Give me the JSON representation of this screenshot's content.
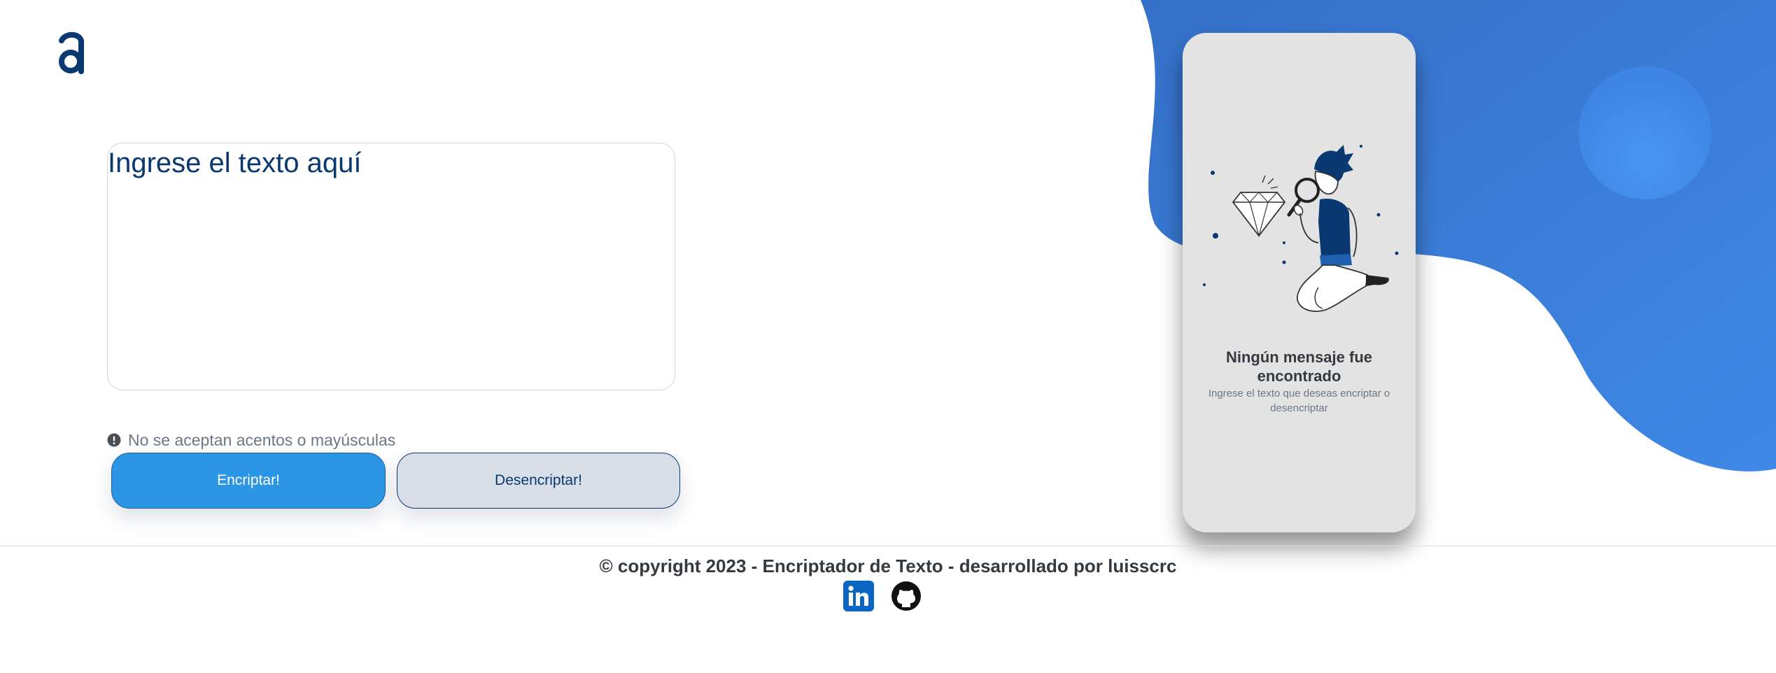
{
  "header": {
    "logo_icon": "alura-logo-icon"
  },
  "input": {
    "placeholder": "Ingrese el texto aquí"
  },
  "warning": {
    "icon": "exclamation-circle-icon",
    "text": "No se aceptan acentos o mayúsculas"
  },
  "buttons": {
    "encrypt_label": "Encriptar!",
    "decrypt_label": "Desencriptar!"
  },
  "output_panel": {
    "illustration": "search-illustration",
    "title": "Ningún mensaje fue encontrado",
    "subtitle": "Ingrese el texto que deseas encriptar o desencriptar"
  },
  "footer": {
    "copyright": "© copyright 2023 - Encriptador de Texto - desarrollado por luisscrc",
    "links": [
      {
        "name": "linkedin-icon"
      },
      {
        "name": "github-icon"
      }
    ]
  },
  "colors": {
    "accent_dark": "#0A3871",
    "accent_blue": "#2B96E3",
    "blob_blue": "#3A7BD5",
    "panel_gray": "#E3E3E3",
    "secondary_button": "#D8DFE8"
  }
}
